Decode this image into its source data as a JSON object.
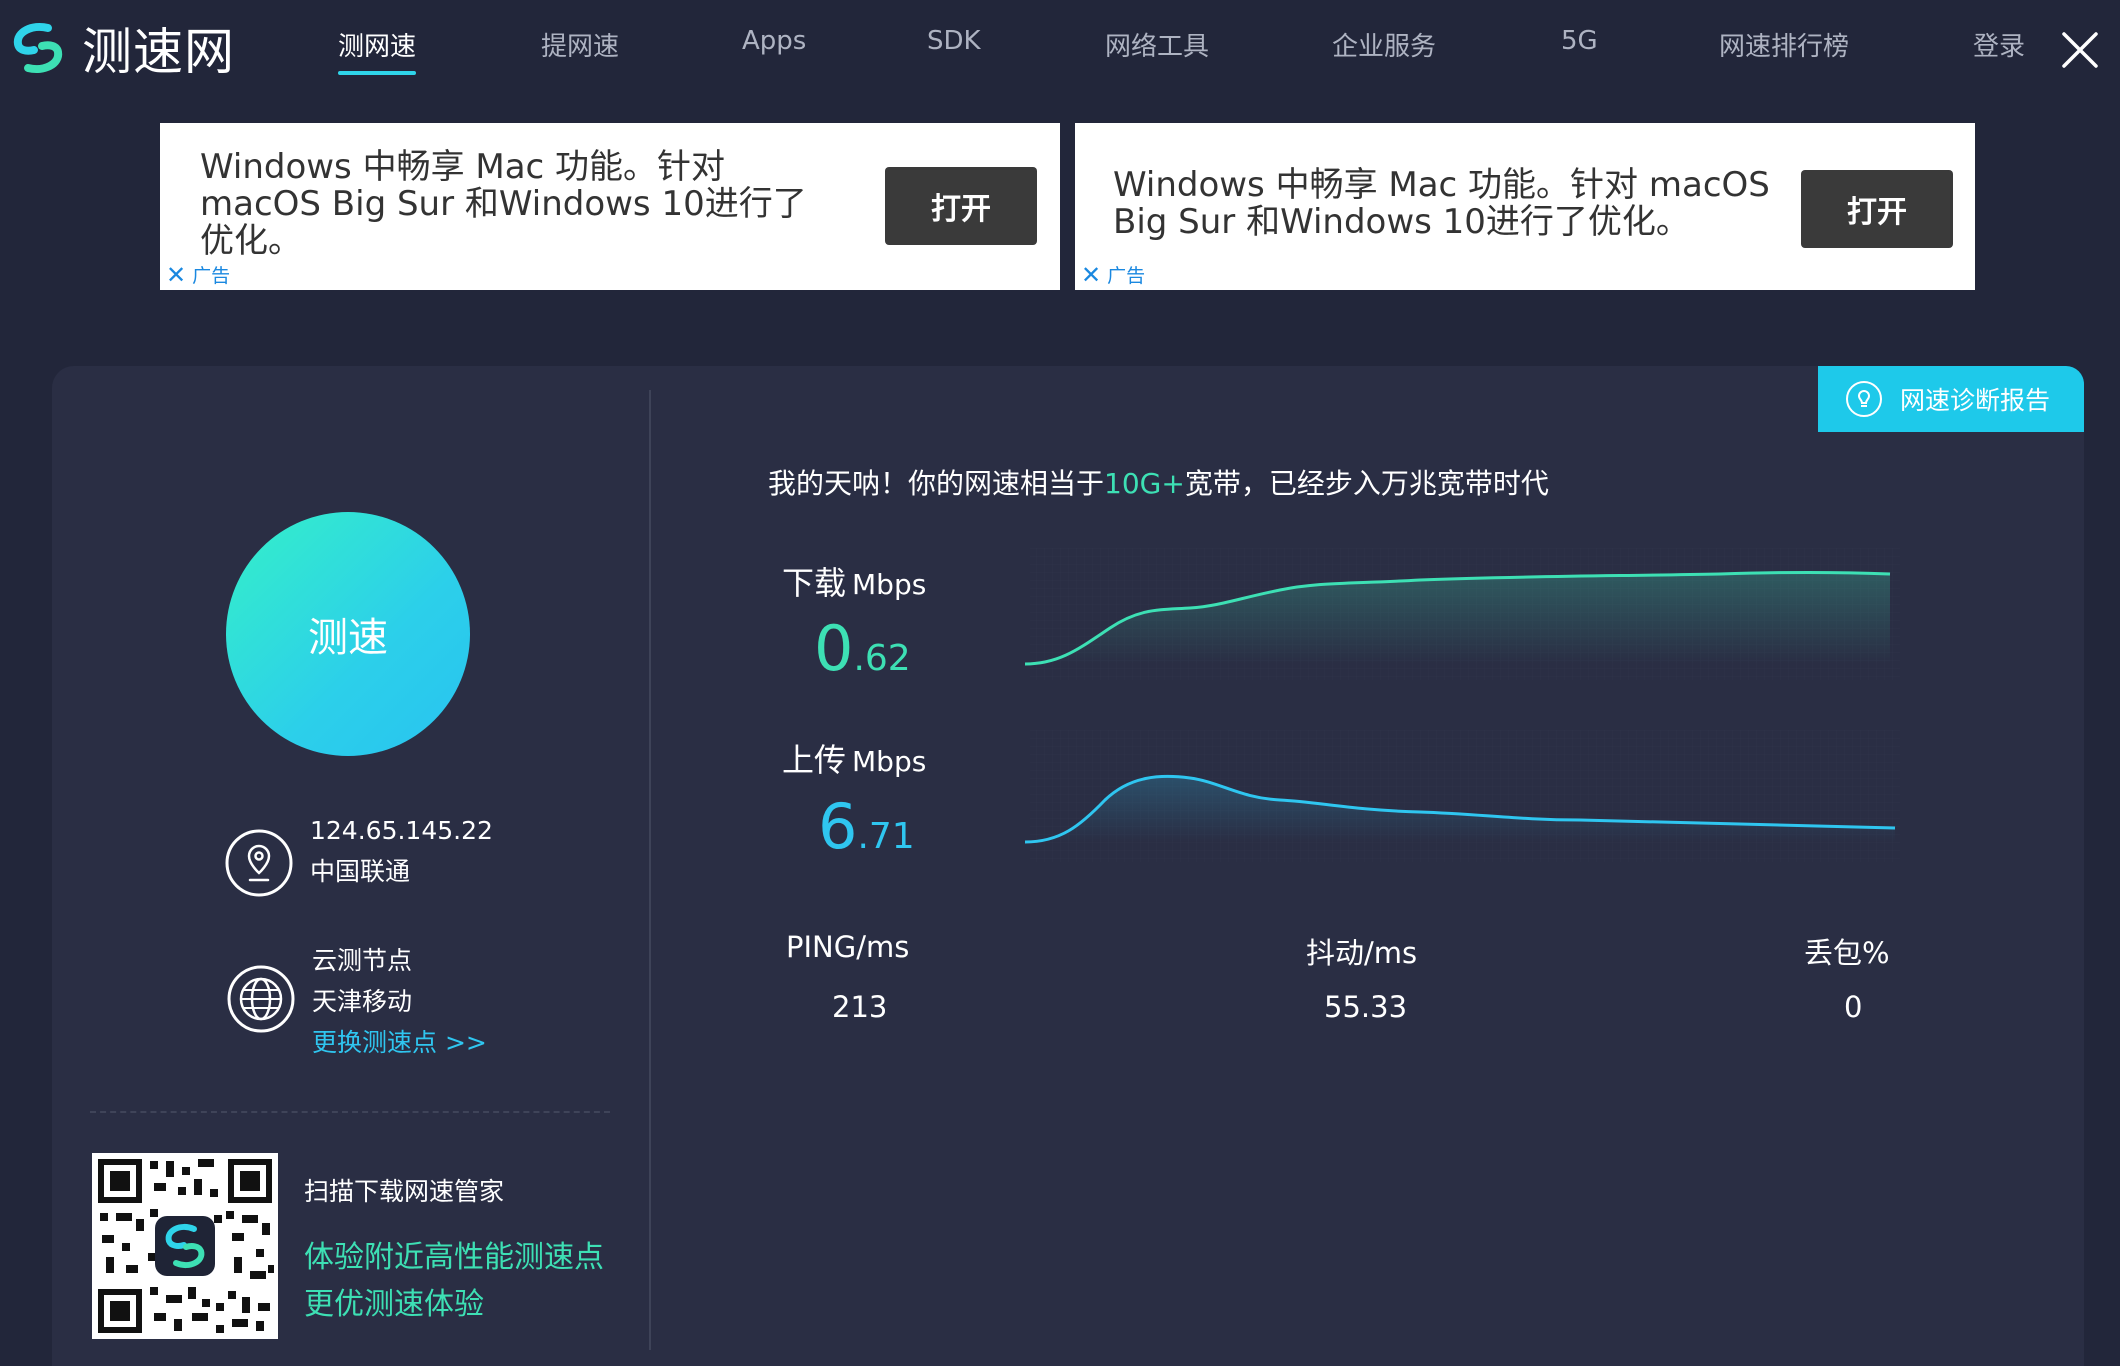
{
  "app": {
    "logo_text": "测速网"
  },
  "nav": {
    "items": [
      {
        "label": "测网速",
        "active": true
      },
      {
        "label": "提网速"
      },
      {
        "label": "Apps"
      },
      {
        "label": "SDK"
      },
      {
        "label": "网络工具"
      },
      {
        "label": "企业服务"
      },
      {
        "label": "5G"
      },
      {
        "label": "网速排行榜"
      },
      {
        "label": "登录"
      }
    ]
  },
  "ads": [
    {
      "lines": [
        "Windows 中畅享 Mac 功能。针对",
        "macOS Big Sur 和Windows 10进行了",
        "优化。"
      ],
      "button": "打开",
      "tag": "广告"
    },
    {
      "lines": [
        "Windows 中畅享 Mac 功能。针对 macOS",
        "Big Sur 和Windows 10进行了优化。"
      ],
      "button": "打开",
      "tag": "广告"
    }
  ],
  "diagnosis_button": "网速诊断报告",
  "speed_button": "测速",
  "client": {
    "ip": "124.65.145.22",
    "isp": "中国联通"
  },
  "node": {
    "label": "云测节点",
    "name": "天津移动",
    "change_link": "更换测速点 >>"
  },
  "promo": {
    "title": "扫描下载网速管家",
    "line1": "体验附近高性能测速点",
    "line2": "更优测速体验"
  },
  "result": {
    "headline_before": "我的天呐！你的网速相当于",
    "headline_highlight": "10G+",
    "headline_after": "宽带，已经步入万兆宽带时代"
  },
  "download": {
    "label": "下载",
    "unit": "Mbps",
    "value_int": "0",
    "value_dec": ".62"
  },
  "upload": {
    "label": "上传",
    "unit": "Mbps",
    "value_int": "6",
    "value_dec": ".71"
  },
  "stats": {
    "ping": {
      "label": "PING/ms",
      "value": "213"
    },
    "jitter": {
      "label": "抖动/ms",
      "value": "55.33"
    },
    "loss": {
      "label": "丢包%",
      "value": "0"
    }
  },
  "colors": {
    "accent_green": "#3de0b4",
    "accent_blue": "#2fc6f0",
    "background": "#22263a",
    "panel": "#2a2e44"
  }
}
